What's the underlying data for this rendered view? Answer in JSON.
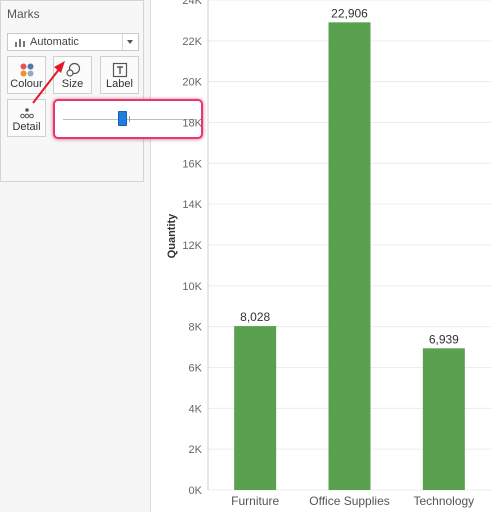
{
  "marks_panel": {
    "title": "Marks",
    "mark_type": {
      "value": "Automatic",
      "icon": "bar-chart-icon"
    },
    "buttons": [
      {
        "label": "Colour",
        "icon": "colour-dots-icon"
      },
      {
        "label": "Size",
        "icon": "size-circles-icon"
      },
      {
        "label": "Label",
        "icon": "label-text-icon"
      },
      {
        "label": "Detail",
        "icon": "detail-dots-icon"
      }
    ]
  },
  "size_slider": {
    "level": 0.45
  },
  "annotation": {
    "color": "#e21b24",
    "highlight_color": "#e8386b"
  },
  "chart_data": {
    "type": "bar",
    "categories": [
      "Furniture",
      "Office Supplies",
      "Technology"
    ],
    "values": [
      8028,
      22906,
      6939
    ],
    "data_labels": [
      "8,028",
      "22,906",
      "6,939"
    ],
    "ylabel": "Quantity",
    "ylim": [
      0,
      24000
    ],
    "ytick_values": [
      0,
      2000,
      4000,
      6000,
      8000,
      10000,
      12000,
      14000,
      16000,
      18000,
      20000,
      22000,
      24000
    ],
    "yticks": [
      "0K",
      "2K",
      "4K",
      "6K",
      "8K",
      "10K",
      "12K",
      "14K",
      "16K",
      "18K",
      "20K",
      "22K",
      "24K"
    ],
    "bar_color": "#59a14f",
    "grid": true
  }
}
